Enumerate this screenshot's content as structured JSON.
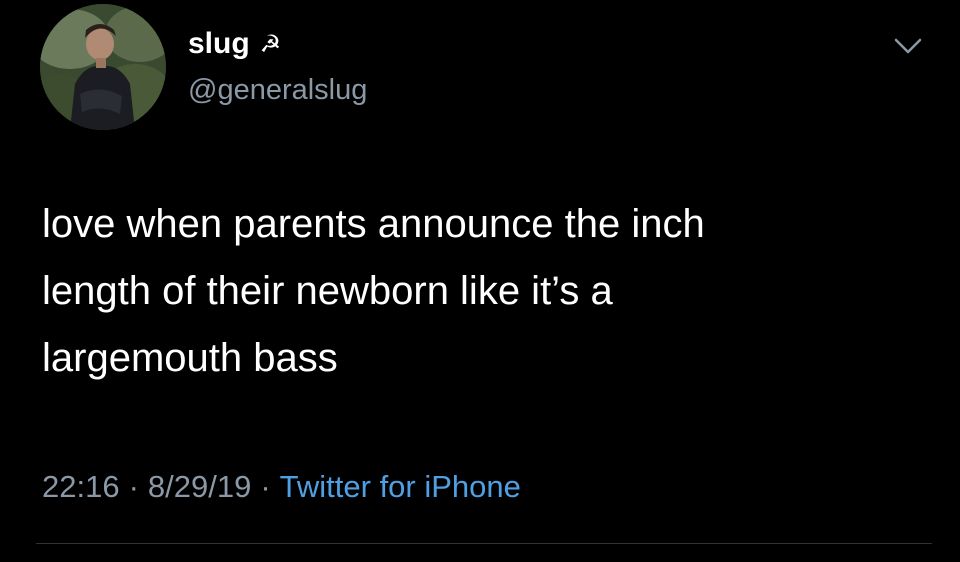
{
  "tweet": {
    "author": {
      "display_name": "slug",
      "name_emoji": "☭",
      "handle": "@generalslug",
      "avatar_icon": "profile-photo"
    },
    "text_lines": [
      "love when parents announce the inch",
      "length of their newborn like it’s a",
      "largemouth bass"
    ],
    "meta": {
      "time": "22:16",
      "separator": "·",
      "date": "8/29/19",
      "source": "Twitter for iPhone"
    },
    "menu_icon": "chevron-down-icon"
  },
  "colors": {
    "background": "#000000",
    "text": "#ffffff",
    "secondary_text": "#8b98a5",
    "link": "#4f9fe3",
    "divider": "#2f3336"
  }
}
